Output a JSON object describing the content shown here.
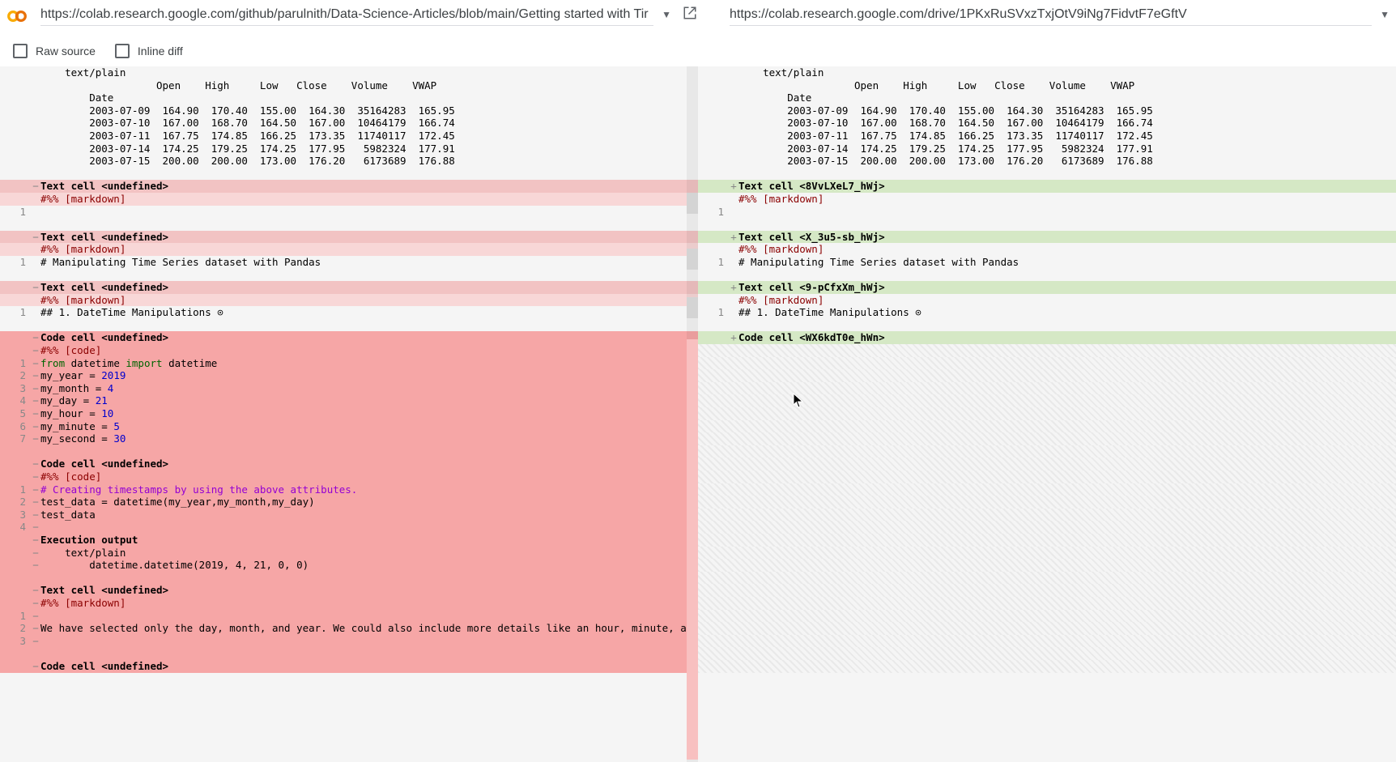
{
  "header": {
    "url_left": "https://colab.research.google.com/github/parulnith/Data-Science-Articles/blob/main/Getting started with Tir",
    "url_right": "https://colab.research.google.com/drive/1PKxRuSVxzTxjOtV9iNg7FidvtF7eGftV"
  },
  "options": {
    "raw_source": "Raw source",
    "inline_diff": "Inline diff"
  },
  "output_common": {
    "mime": "text/plain",
    "cols": "           Open    High     Low   Close    Volume    VWAP",
    "date": "Date",
    "rows": [
      "2003-07-09  164.90  170.40  155.00  164.30  35164283  165.95",
      "2003-07-10  167.00  168.70  164.50  167.00  10464179  166.74",
      "2003-07-11  167.75  174.85  166.25  173.35  11740117  172.45",
      "2003-07-14  174.25  179.25  174.25  177.95   5982324  177.91",
      "2003-07-15  200.00  200.00  173.00  176.20   6173689  176.88"
    ]
  },
  "left": {
    "cells": [
      {
        "header": "Text cell <undefined>",
        "tag": "#%% [markdown]",
        "lines": [
          ""
        ]
      },
      {
        "header": "Text cell <undefined>",
        "tag": "#%% [markdown]",
        "lines": [
          "# Manipulating Time Series dataset with Pandas"
        ]
      },
      {
        "header": "Text cell <undefined>",
        "tag": "#%% [markdown]",
        "lines": [
          "## 1. DateTime Manipulations ⊙"
        ]
      }
    ],
    "removed_code1": {
      "header": "Code cell <undefined>",
      "tag": "#%% [code]",
      "lines": [
        {
          "pre": "from ",
          "kw": "",
          "rest": "datetime ",
          "kw2": "import ",
          "rest2": "datetime"
        },
        "my_year = 2019",
        "my_month = 4",
        "my_day = 21",
        "my_hour = 10",
        "my_minute = 5",
        "my_second = 30"
      ]
    },
    "removed_code2": {
      "header": "Code cell <undefined>",
      "tag": "#%% [code]",
      "lines": [
        "# Creating timestamps by using the above attributes.",
        "test_data = datetime(my_year,my_month,my_day)",
        "test_data",
        ""
      ]
    },
    "removed_exec": {
      "header": "Execution output",
      "mime": "text/plain",
      "value": "datetime.datetime(2019, 4, 21, 0, 0)"
    },
    "removed_text": {
      "header": "Text cell <undefined>",
      "tag": "#%% [markdown]",
      "lines": [
        "",
        "We have selected only the day, month, and year. We could also include more details like an hour, minute, and secon",
        ""
      ]
    },
    "removed_tail": {
      "header": "Code cell <undefined>"
    }
  },
  "right": {
    "cells": [
      {
        "header": "Text cell <8VvLXeL7_hWj>",
        "tag": "#%% [markdown]",
        "lines": [
          ""
        ]
      },
      {
        "header": "Text cell <X_3u5-sb_hWj>",
        "tag": "#%% [markdown]",
        "lines": [
          "# Manipulating Time Series dataset with Pandas"
        ]
      },
      {
        "header": "Text cell <9-pCfxXm_hWj>",
        "tag": "#%% [markdown]",
        "lines": [
          "## 1. DateTime Manipulations ⊙"
        ]
      }
    ],
    "added_code": {
      "header": "Code cell <WX6kdT0e_hWn>"
    }
  }
}
